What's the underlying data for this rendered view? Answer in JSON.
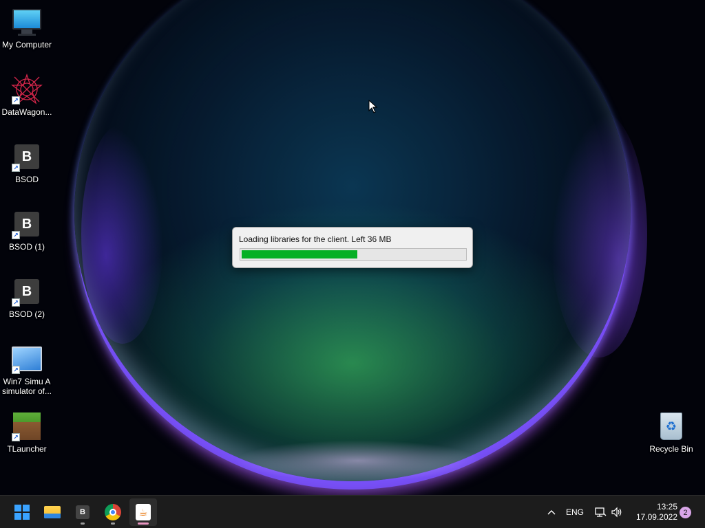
{
  "desktop": {
    "icons": [
      {
        "label": "My Computer",
        "icon": "monitor-icon"
      },
      {
        "label": "DataWagon...",
        "icon": "datawagon-icon"
      },
      {
        "label": "BSOD",
        "icon": "bsod-app-icon",
        "glyph": "B"
      },
      {
        "label": "BSOD (1)",
        "icon": "bsod-app-icon",
        "glyph": "B"
      },
      {
        "label": "BSOD (2)",
        "icon": "bsod-app-icon",
        "glyph": "B"
      },
      {
        "label": "Win7 Simu A\nsimulator of...",
        "icon": "win7-simulator-icon"
      },
      {
        "label": "TLauncher",
        "icon": "minecraft-grass-block-icon"
      },
      {
        "label": "Recycle Bin",
        "icon": "recycle-bin-icon"
      }
    ]
  },
  "dialog": {
    "message": "Loading libraries for the client. Left 36 MB",
    "progress_fraction": 0.52,
    "progress_color": "#06b025"
  },
  "taskbar": {
    "apps": [
      {
        "name": "start",
        "icon": "windows-logo-icon"
      },
      {
        "name": "file-explorer",
        "icon": "folder-icon"
      },
      {
        "name": "bsod",
        "icon": "bsod-app-icon",
        "glyph": "B"
      },
      {
        "name": "chrome",
        "icon": "chrome-icon"
      },
      {
        "name": "java",
        "icon": "java-icon",
        "glyph": "☕"
      }
    ],
    "tray": {
      "overflow_icon": "chevron-up-icon",
      "language": "ENG",
      "network_icon": "network-icon",
      "volume_icon": "volume-icon",
      "time": "13:25",
      "date": "17.09.2022",
      "notification_count": "2"
    }
  }
}
